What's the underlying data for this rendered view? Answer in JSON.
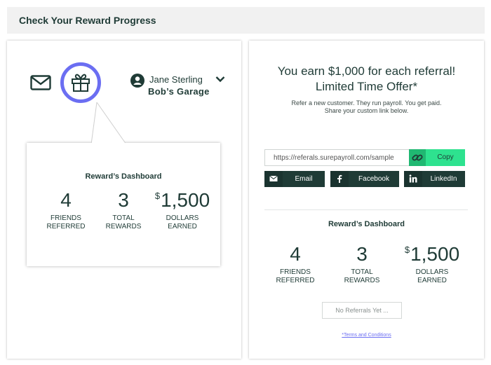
{
  "header": {
    "title": "Check Your Reward Progress"
  },
  "user": {
    "name": "Jane Sterling",
    "company": "Bob’s Garage"
  },
  "popover_dashboard": {
    "title": "Reward’s Dashboard",
    "stats": [
      {
        "number": "4",
        "label_1": "FRIENDS",
        "label_2": "REFERRED"
      },
      {
        "number": "3",
        "label_1": "TOTAL",
        "label_2": "REWARDS"
      },
      {
        "prefix": "$",
        "number": "1,500",
        "label_1": "DOLLARS",
        "label_2": "EARNED"
      }
    ]
  },
  "offer": {
    "heading_line_1": "You earn $1,000 for each referral!",
    "heading_line_2": "Limited Time Offer*",
    "sub_line_1": "Refer a new customer. They run payroll. You get paid.",
    "sub_line_2": "Share your custom link below."
  },
  "share": {
    "link_value": "https://referals.surepayroll.com/sample",
    "copy_label": "Copy",
    "email_label": "Email",
    "facebook_label": "Facebook",
    "linkedin_label": "LinkedIn"
  },
  "right_dashboard": {
    "title": "Reward’s Dashboard",
    "stats": [
      {
        "number": "4",
        "label_1": "FRIENDS",
        "label_2": "REFERRED"
      },
      {
        "number": "3",
        "label_1": "TOTAL",
        "label_2": "REWARDS"
      },
      {
        "prefix": "$",
        "number": "1,500",
        "label_1": "DOLLARS",
        "label_2": "EARNED"
      }
    ],
    "no_referrals": "No Referrals Yet ...",
    "terms": "*Terms and Conditions"
  },
  "colors": {
    "primary_dark": "#1f3b36",
    "accent_purple": "#6b6ef2",
    "copy_green": "#2ee28f",
    "header_bg": "#f1f1f1"
  }
}
